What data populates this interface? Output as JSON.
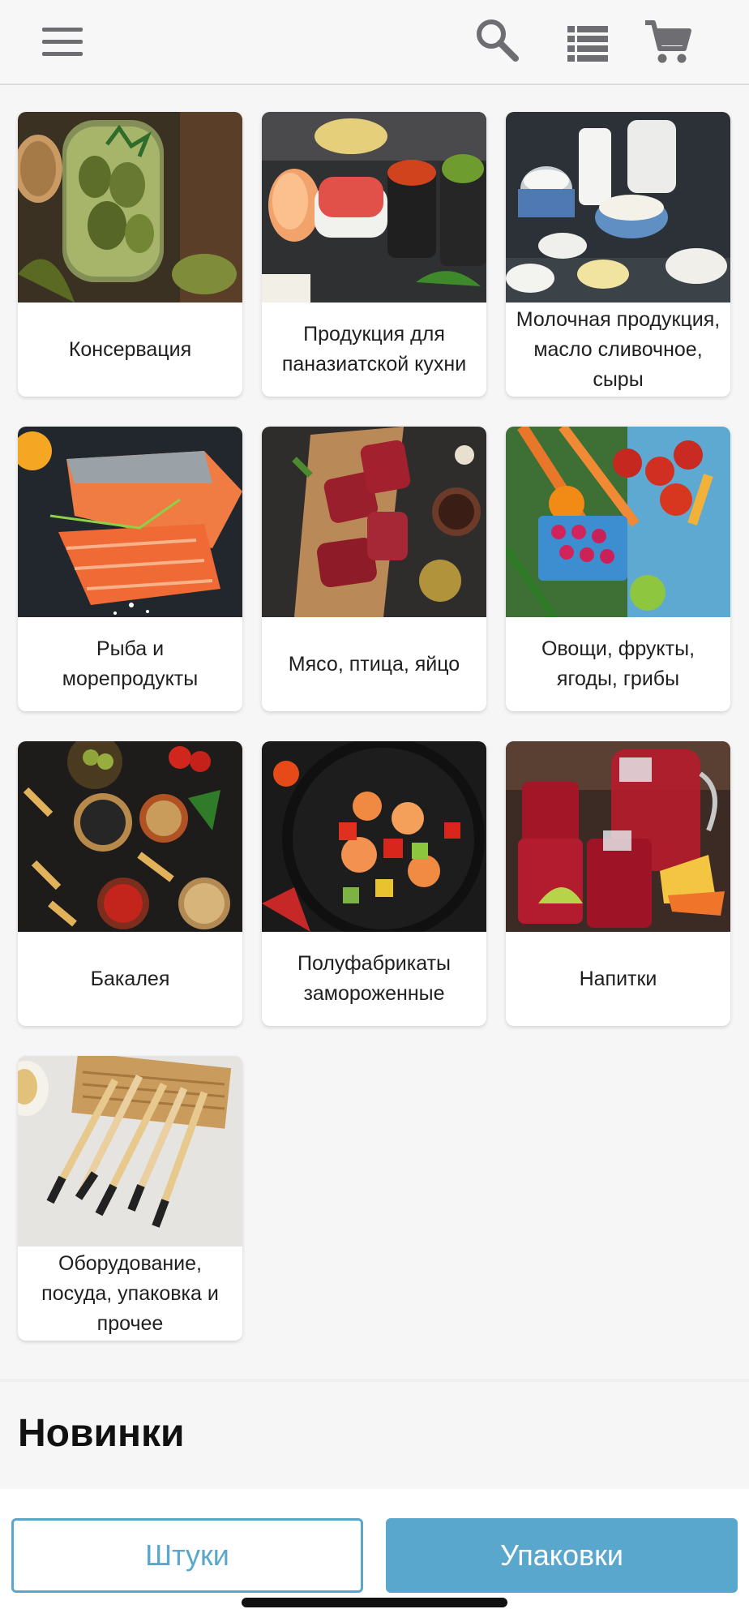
{
  "header": {
    "menu_icon": "hamburger-menu-icon",
    "search_icon": "search-icon",
    "list_icon": "list-view-icon",
    "cart_icon": "cart-icon",
    "accent_color": "#5aa7cd"
  },
  "categories": [
    {
      "label": "Консервация",
      "image": "pickled-cucumbers-jar"
    },
    {
      "label": "Продукция для паназиатской кухни",
      "image": "sushi-and-rolls"
    },
    {
      "label": "Молочная продукция, масло сливочное, сыры",
      "image": "dairy-products"
    },
    {
      "label": "Рыба и морепродукты",
      "image": "salmon-fillet"
    },
    {
      "label": "Мясо, птица, яйцо",
      "image": "raw-meat-board"
    },
    {
      "label": "Овощи, фрукты, ягоды, грибы",
      "image": "vegetables-fruits-berries"
    },
    {
      "label": "Бакалея",
      "image": "spices-pasta-grains"
    },
    {
      "label": "Полуфабрикаты замороженные",
      "image": "shrimp-vegetable-pan"
    },
    {
      "label": "Напитки",
      "image": "red-drinks-ice"
    },
    {
      "label": "Оборудование, посуда, упаковка и прочее",
      "image": "chopsticks-bamboo-mat"
    }
  ],
  "section": {
    "title": "Новинки"
  },
  "bottom": {
    "pieces_label": "Штуки",
    "packs_label": "Упаковки"
  }
}
